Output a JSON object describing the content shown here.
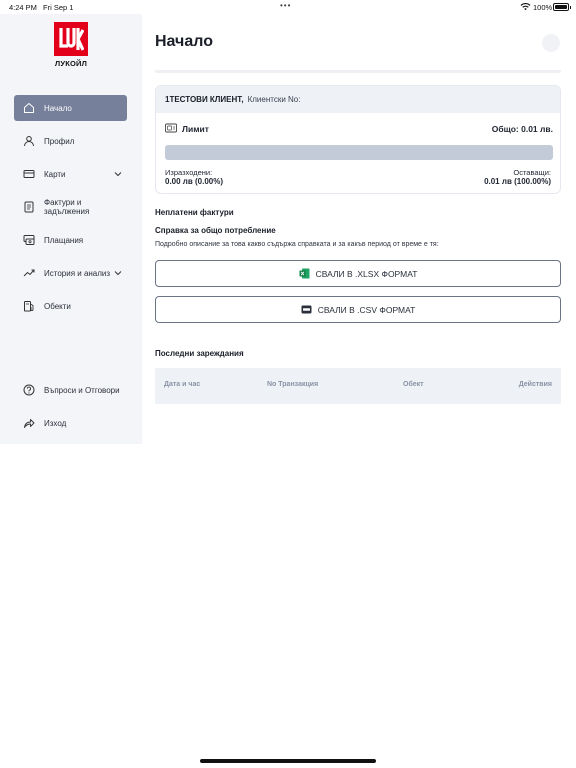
{
  "status_bar": {
    "time": "4:24 PM",
    "date": "Fri Sep 1",
    "battery": "100%"
  },
  "brand": {
    "logo_text": "ЛУКОЙЛ",
    "logo_color": "#e3001b"
  },
  "sidebar": {
    "items": [
      {
        "label": "Начало",
        "icon": "home-icon",
        "active": true
      },
      {
        "label": "Профил",
        "icon": "user-icon"
      },
      {
        "label": "Карти",
        "icon": "card-icon",
        "has_chevron": true
      },
      {
        "label": "Фактури и задължения",
        "icon": "invoice-icon"
      },
      {
        "label": "Плащания",
        "icon": "payment-icon"
      },
      {
        "label": "История и анализ",
        "icon": "chart-icon",
        "has_chevron": true
      },
      {
        "label": "Обекти",
        "icon": "station-icon"
      }
    ],
    "bottom_items": [
      {
        "label": "Въпроси и Отговори",
        "icon": "help-icon"
      },
      {
        "label": "Изход",
        "icon": "logout-icon"
      }
    ],
    "active_color": "#76809b"
  },
  "page": {
    "title": "Начало"
  },
  "card": {
    "client_name": "1ТЕСТОВИ КЛИЕНТ,",
    "client_no_label": "Клиентски No:",
    "limit_label": "Лимит",
    "total": "Общо: 0.01 лв.",
    "spent_label": "Изразходени:",
    "spent_value": "0.00 лв (0.00%)",
    "remaining_label": "Оставащи:",
    "remaining_value": "0.01 лв (100.00%)",
    "spent_fraction": 0.0
  },
  "unpaid_invoices": {
    "title": "Неплатени фактури"
  },
  "report": {
    "title": "Справка за общо потребление",
    "description": "Подробно описание за това какво съдържа справката и за какъв период от време е тя:",
    "xlsx_button": "СВАЛИ В .XLSX ФОРМАТ",
    "csv_button": "СВАЛИ В .CSV ФОРМАТ"
  },
  "recent_fuelings": {
    "title": "Последни зареждания",
    "columns": [
      "Дата и час",
      "No Транзакция",
      "Обект",
      "Действия"
    ]
  }
}
